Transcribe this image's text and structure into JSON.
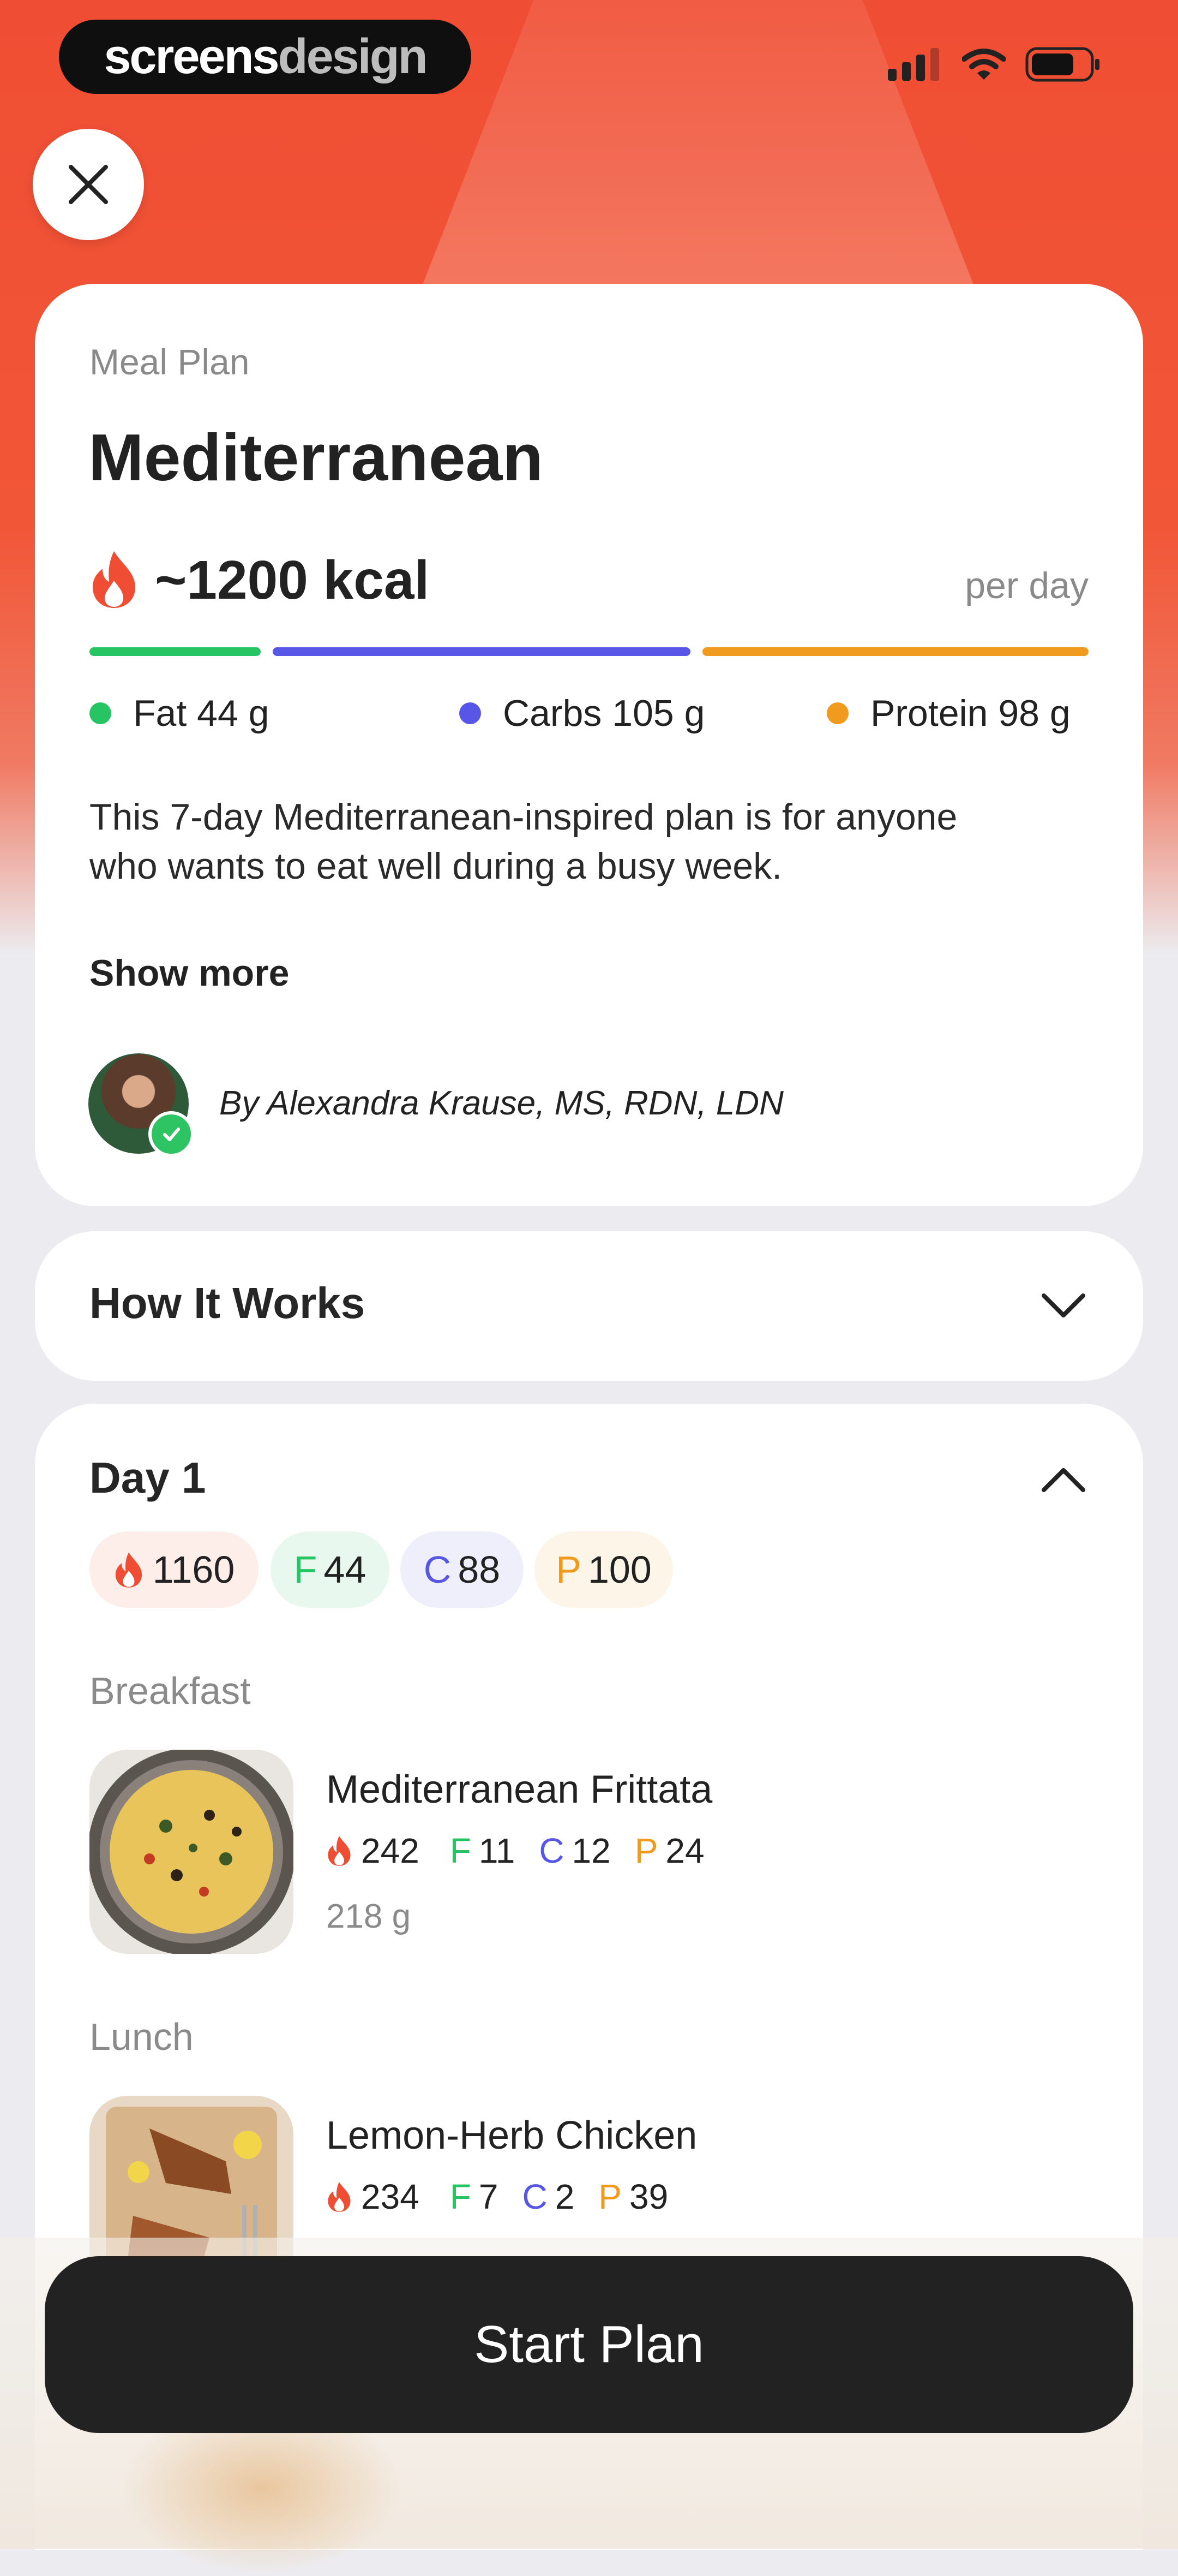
{
  "watermark": {
    "part1": "screens",
    "part2": "design"
  },
  "status_bar": {
    "icons": [
      "signal-icon",
      "wifi-icon",
      "battery-icon"
    ]
  },
  "colors": {
    "accent": "#f04e34",
    "fat": "#27c463",
    "carbs": "#5856e6",
    "protein": "#f09a1e",
    "dark": "#222222"
  },
  "header": {
    "close_icon": "close-icon"
  },
  "plan": {
    "label": "Meal Plan",
    "title": "Mediterranean",
    "kcal": "~1200 kcal",
    "per_day": "per day",
    "macros": {
      "fat": "Fat 44 g",
      "carbs": "Carbs 105 g",
      "protein": "Protein 98 g"
    },
    "description_line1": "This 7-day Mediterranean-inspired plan is for anyone",
    "description_line2": "who wants to eat well during a busy week.",
    "show_more": "Show more",
    "author": "By Alexandra Krause, MS, RDN, LDN"
  },
  "how_it_works": {
    "title": "How It Works"
  },
  "day": {
    "title": "Day 1",
    "pills": {
      "kcal": "1160",
      "fat_letter": "F",
      "fat": "44",
      "carbs_letter": "C",
      "carbs": "88",
      "protein_letter": "P",
      "protein": "100"
    },
    "meals": [
      {
        "section": "Breakfast",
        "name": "Mediterranean Frittata",
        "kcal": "242",
        "fat": "11",
        "carbs": "12",
        "protein": "24",
        "weight": "218 g"
      },
      {
        "section": "Lunch",
        "name": "Lemon-Herb Chicken",
        "kcal": "234",
        "fat": "7",
        "carbs": "2",
        "protein": "39"
      }
    ],
    "letters": {
      "f": "F",
      "c": "C",
      "p": "P"
    }
  },
  "cta": {
    "start": "Start Plan"
  }
}
